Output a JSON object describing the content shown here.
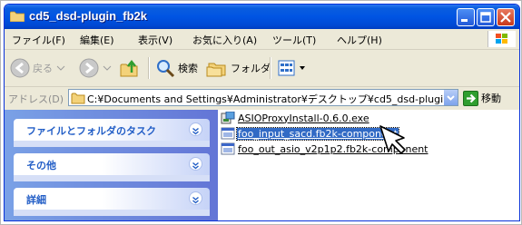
{
  "window": {
    "title": "cd5_dsd-plugin_fb2k",
    "icon": "folder-icon",
    "controls": [
      "minimize-icon",
      "maximize-icon",
      "close-icon"
    ]
  },
  "menubar": {
    "items": [
      "ファイル(F)",
      "編集(E)",
      "表示(V)",
      "お気に入り(A)",
      "ツール(T)",
      "ヘルプ(H)"
    ]
  },
  "toolbar": {
    "back_label": "戻る",
    "search_label": "検索",
    "folders_label": "フォルダ"
  },
  "address": {
    "label": "アドレス(D)",
    "value": "C:¥Documents and Settings¥Administrator¥デスクトップ¥cd5_dsd-plugin_fb2k",
    "go_label": "移動"
  },
  "tasks": {
    "items": [
      {
        "label": "ファイルとフォルダのタスク"
      },
      {
        "label": "その他"
      },
      {
        "label": "詳細"
      }
    ]
  },
  "files": [
    {
      "name": "ASIOProxyInstall-0.6.0.exe",
      "icon": "installer-icon",
      "selected": false
    },
    {
      "name": "foo_input_sacd.fb2k-component",
      "icon": "component-file-icon",
      "selected": true
    },
    {
      "name": "foo_out_asio_v2p1p2.fb2k-component",
      "icon": "component-file-icon",
      "selected": false
    }
  ],
  "colors": {
    "titlebar": "#0054e3",
    "task_pane": "#6375d6",
    "selection": "#316ac5",
    "task_label": "#215dc6"
  }
}
